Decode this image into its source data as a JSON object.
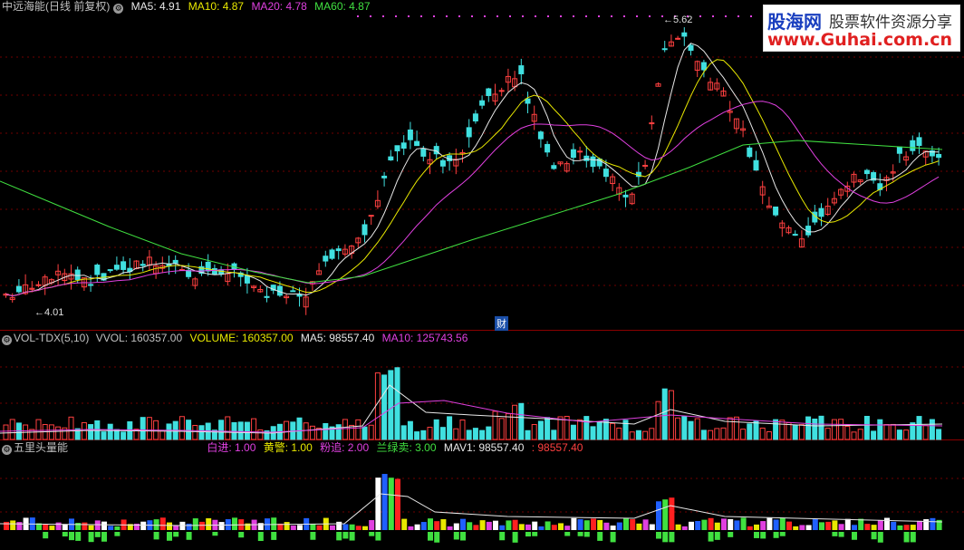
{
  "main_panel": {
    "stock_title": "中远海能(日线 前复权)",
    "gear_icon": "gear-icon",
    "indicators": [
      {
        "label": "MA5: 4.91",
        "color": "#e8e8e8"
      },
      {
        "label": "MA10: 4.87",
        "color": "#e8e800"
      },
      {
        "label": "MA20: 4.78",
        "color": "#e040e0"
      },
      {
        "label": "MA60: 4.87",
        "color": "#40e040"
      }
    ],
    "high_label": "5.62",
    "low_label": "4.01",
    "marker_label": "财"
  },
  "volume_panel": {
    "title": "VOL-TDX(5,10)",
    "items": [
      {
        "label": "VVOL: 160357.00",
        "color": "#c0c0c0"
      },
      {
        "label": "VOLUME: 160357.00",
        "color": "#e8e800"
      },
      {
        "label": "MA5: 98557.40",
        "color": "#e8e8e8"
      },
      {
        "label": "MA10: 125743.56",
        "color": "#e040e0"
      }
    ]
  },
  "energy_panel": {
    "title": "五里头量能",
    "items": [
      {
        "label": "白进: 1.00",
        "color": "#e040e0"
      },
      {
        "label": "黄警: 1.00",
        "color": "#e8e800"
      },
      {
        "label": "粉追: 2.00",
        "color": "#e040e0"
      },
      {
        "label": "兰绿卖: 3.00",
        "color": "#40e040"
      },
      {
        "label": "MAV1: 98557.40",
        "color": "#e8e8e8"
      },
      {
        "label": ": 98557.40",
        "color": "#ff4040"
      }
    ]
  },
  "watermark": {
    "brand": "股海网",
    "tagline": "股票软件资源分享",
    "url": "www.Guhai.com.cn"
  },
  "colors": {
    "up": "#ff4040",
    "down": "#40e0e0",
    "background": "#000000",
    "separator": "#8a0000"
  }
}
